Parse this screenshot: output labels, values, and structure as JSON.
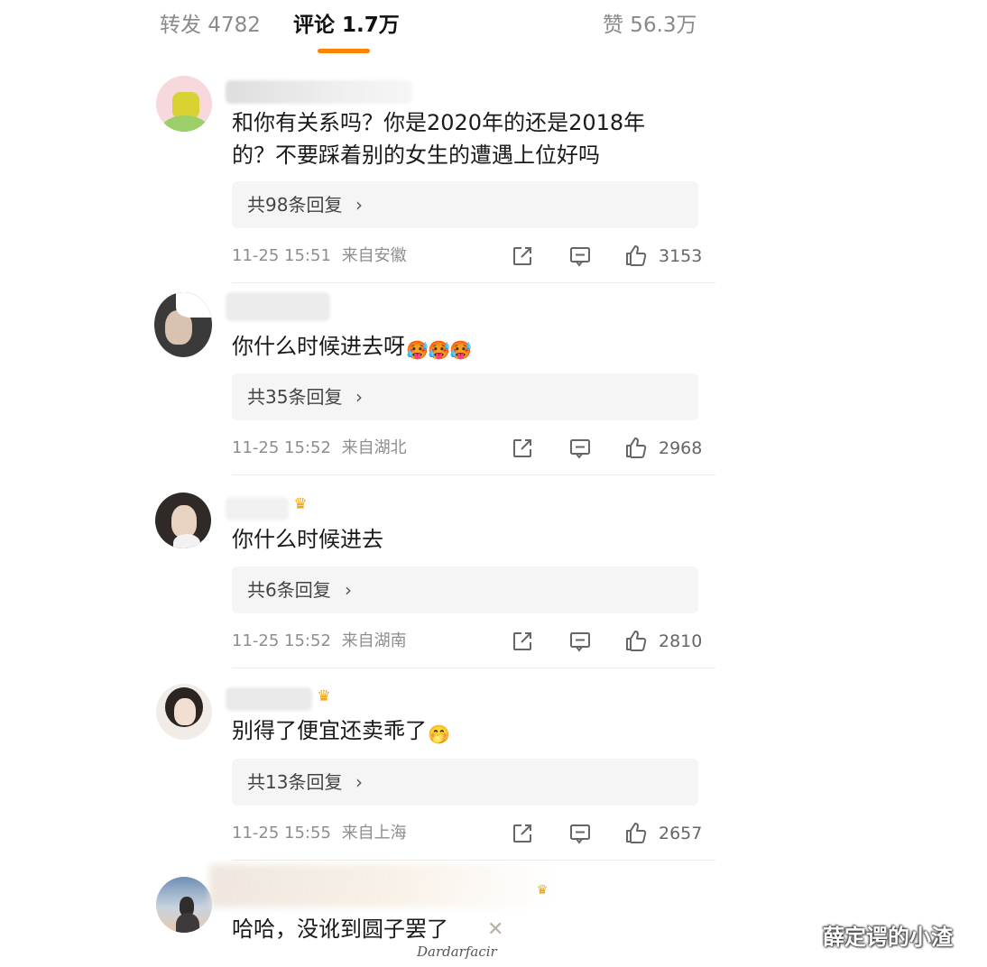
{
  "tabs": {
    "repost": "转发 4782",
    "comments": "评论 1.7万",
    "likes": "赞 56.3万"
  },
  "colors": {
    "accent": "#ff8200",
    "reply_bg": "#f5f5f5",
    "meta": "#8e8e8e"
  },
  "icons": {
    "share": "share-icon",
    "comment": "comment-icon",
    "like": "thumbs-up-icon",
    "vip": "crown-icon",
    "chevron": "chevron-right-icon"
  },
  "comments": [
    {
      "text_lines": [
        "和你有关系吗？你是2020年的还是2018年",
        "的？不要踩着别的女生的遭遇上位好吗"
      ],
      "emojis": [],
      "replies": "共98条回复",
      "time": "11-25 15:51",
      "location": "来自安徽",
      "likes": "3153"
    },
    {
      "text_lines": [
        "你什么时候进去呀"
      ],
      "emojis": [
        "🥵",
        "🥵",
        "🥵"
      ],
      "replies": "共35条回复",
      "time": "11-25 15:52",
      "location": "来自湖北",
      "likes": "2968"
    },
    {
      "text_lines": [
        "你什么时候进去"
      ],
      "emojis": [],
      "replies": "共6条回复",
      "time": "11-25 15:52",
      "location": "来自湖南",
      "likes": "2810"
    },
    {
      "text_lines": [
        "别得了便宜还卖乖了"
      ],
      "emojis": [
        "🤭"
      ],
      "replies": "共13条回复",
      "time": "11-25 15:55",
      "location": "来自上海",
      "likes": "2657"
    },
    {
      "text_lines": [
        "哈哈，没讹到圆子罢了"
      ],
      "emojis": []
    }
  ],
  "chevron": "›",
  "watermark": "薛定谔的小渣"
}
